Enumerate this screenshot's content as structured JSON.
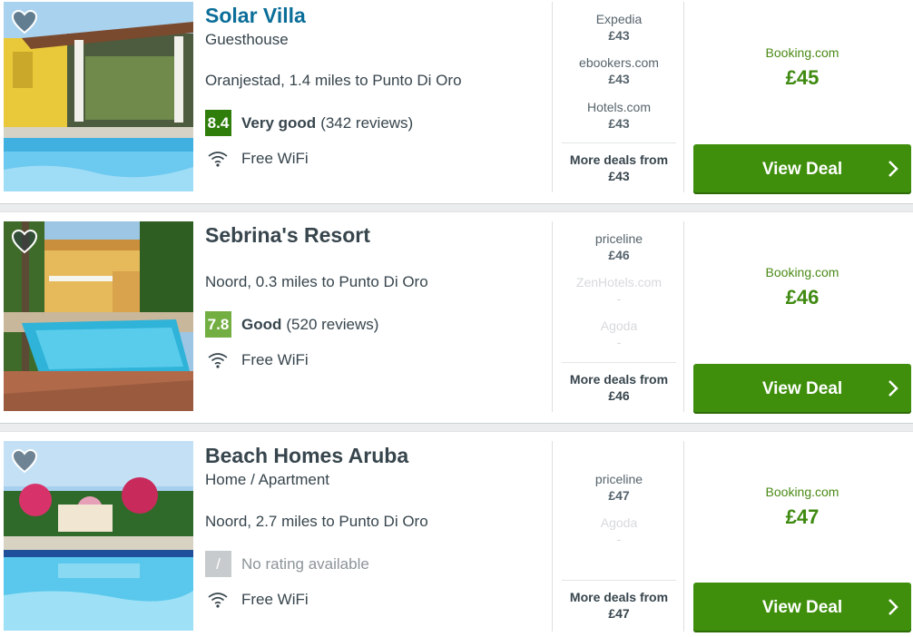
{
  "hotels": [
    {
      "name": "Solar Villa",
      "type": "Guesthouse",
      "location": "Oranjestad, 1.4 miles to Punto Di Oro",
      "rating": {
        "score": "8.4",
        "label": "Very good",
        "reviews": "(342 reviews)"
      },
      "amenity": "Free WiFi",
      "deals": [
        {
          "site": "Expedia",
          "price": "£43"
        },
        {
          "site": "ebookers.com",
          "price": "£43"
        },
        {
          "site": "Hotels.com",
          "price": "£43"
        }
      ],
      "more_label": "More deals from",
      "more_price": "£43",
      "main_provider": "Booking.com",
      "main_price": "£45",
      "button": "View Deal"
    },
    {
      "name": "Sebrina's Resort",
      "type": "",
      "location": "Noord, 0.3 miles to Punto Di Oro",
      "rating": {
        "score": "7.8",
        "label": "Good",
        "reviews": "(520 reviews)"
      },
      "amenity": "Free WiFi",
      "deals": [
        {
          "site": "priceline",
          "price": "£46"
        },
        {
          "site": "ZenHotels.com",
          "price": "-"
        },
        {
          "site": "Agoda",
          "price": "-"
        }
      ],
      "more_label": "More deals from",
      "more_price": "£46",
      "main_provider": "Booking.com",
      "main_price": "£46",
      "button": "View Deal"
    },
    {
      "name": "Beach Homes Aruba",
      "type": "Home / Apartment",
      "location": "Noord, 2.7 miles to Punto Di Oro",
      "rating": {
        "score": "/",
        "label": "",
        "reviews": "No rating available"
      },
      "amenity": "Free WiFi",
      "deals": [
        {
          "site": "priceline",
          "price": "£47"
        },
        {
          "site": "Agoda",
          "price": "-"
        }
      ],
      "more_label": "More deals from",
      "more_price": "£47",
      "main_provider": "Booking.com",
      "main_price": "£47",
      "button": "View Deal"
    }
  ],
  "colors": {
    "link": "#0b6e99",
    "green_button": "#3f8f0c",
    "price_green": "#3f8a10",
    "badge_very_good": "#2f7e0c",
    "badge_good": "#73ae42",
    "badge_none": "#c8cbcd"
  },
  "icons": [
    "heart-icon",
    "wifi-icon",
    "chevron-right-icon"
  ]
}
